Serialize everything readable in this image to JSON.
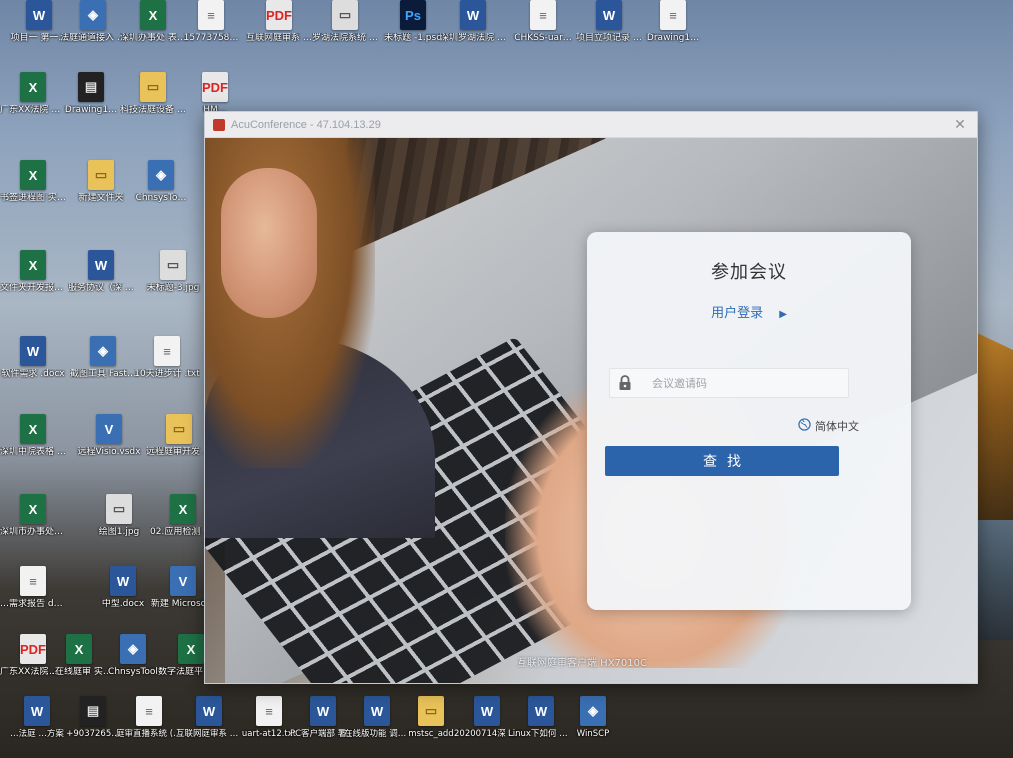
{
  "desktop": {
    "icons": [
      {
        "label": "项目一 第一…",
        "type": "docx",
        "glyph": "W"
      },
      {
        "label": "法庭通道接入 程序",
        "type": "app",
        "glyph": "◈"
      },
      {
        "label": "深圳办事处 表.xlsx",
        "type": "xlsx",
        "glyph": "X"
      },
      {
        "label": "15773758…",
        "type": "txt",
        "glyph": "≡"
      },
      {
        "label": "互联网庭审系 统.pdf",
        "type": "pdf",
        "glyph": "PDF"
      },
      {
        "label": "罗湖法院系统 ID.jpg",
        "type": "img",
        "glyph": "▭"
      },
      {
        "label": "未标题 -1.psd",
        "type": "psd",
        "glyph": "Ps"
      },
      {
        "label": "深圳罗湖法院 安装.docx",
        "type": "docx",
        "glyph": "W"
      },
      {
        "label": "CHKSS-uar…",
        "type": "txt",
        "glyph": "≡"
      },
      {
        "label": "项目立项记录 书面.docx",
        "type": "docx",
        "glyph": "W"
      },
      {
        "label": "Drawing1…",
        "type": "txt",
        "glyph": "≡"
      },
      {
        "label": "广东XX法院 庭审…",
        "type": "xlsx",
        "glyph": "X"
      },
      {
        "label": "Drawing1…",
        "type": "dark",
        "glyph": "▤"
      },
      {
        "label": "科技法庭设备 采购（初验）",
        "type": "folder",
        "glyph": "▭"
      },
      {
        "label": "HM…",
        "type": "pdf",
        "glyph": "PDF"
      },
      {
        "label": "书签进程图 实施.xlsx",
        "type": "xlsx",
        "glyph": "X"
      },
      {
        "label": "新建文件夹",
        "type": "folder",
        "glyph": "▭"
      },
      {
        "label": "ChnsysTo…",
        "type": "app",
        "glyph": "◈"
      },
      {
        "label": "文件夹开发报价 书.xlsx",
        "type": "xlsx",
        "glyph": "X"
      },
      {
        "label": "服务协议（深 圳）…",
        "type": "docx",
        "glyph": "W"
      },
      {
        "label": "未标题-3.jpg",
        "type": "img",
        "glyph": "▭"
      },
      {
        "label": "软件需求 .docx",
        "type": "docx",
        "glyph": "W"
      },
      {
        "label": "截图工具 FastStone …",
        "type": "app",
        "glyph": "◈"
      },
      {
        "label": "10天进步计 .txt",
        "type": "txt",
        "glyph": "≡"
      },
      {
        "label": "深圳中院表格 远程庭审…",
        "type": "xlsx",
        "glyph": "X"
      },
      {
        "label": "远程Visio.vsdx",
        "type": "app",
        "glyph": "V"
      },
      {
        "label": "远程庭审开发 实施",
        "type": "folder",
        "glyph": "▭"
      },
      {
        "label": "深圳市办事处设 备2020…",
        "type": "xlsx",
        "glyph": "X"
      },
      {
        "label": "绘图1.jpg",
        "type": "img",
        "glyph": "▭"
      },
      {
        "label": "02.应用检测 表.xlsx",
        "type": "xlsx",
        "glyph": "X"
      },
      {
        "label": "…需求报告 docx",
        "type": "txt",
        "glyph": "≡"
      },
      {
        "label": "中型.docx",
        "type": "docx",
        "glyph": "W"
      },
      {
        "label": "新建 Microso…",
        "type": "app",
        "glyph": "V"
      },
      {
        "label": "广东XX法院 实施计划…",
        "type": "pdf",
        "glyph": "PDF"
      },
      {
        "label": "…在线庭审 实施…",
        "type": "xlsx",
        "glyph": "X"
      },
      {
        "label": "ChnsysTool",
        "type": "app",
        "glyph": "◈"
      },
      {
        "label": "数字法庭平 台设备清单…",
        "type": "xlsx",
        "glyph": "X"
      }
    ],
    "bottom_icons": [
      {
        "label": "…法庭 …方案",
        "type": "docx",
        "glyph": "W"
      },
      {
        "label": "+9037265…",
        "type": "dark",
        "glyph": "▤"
      },
      {
        "label": "庭审直播系统 (2019102…",
        "type": "txt",
        "glyph": "≡"
      },
      {
        "label": "互联网庭审系 统说明 书…",
        "type": "docx",
        "glyph": "W"
      },
      {
        "label": "uart-at12.txt",
        "type": "txt",
        "glyph": "≡"
      },
      {
        "label": "PC客户端部 署使用说…",
        "type": "docx",
        "glyph": "W"
      },
      {
        "label": "在线版功能 调试说明…",
        "type": "docx",
        "glyph": "W"
      },
      {
        "label": "mstsc_add",
        "type": "folder",
        "glyph": "▭"
      },
      {
        "label": "20200714深 圳远程庭审…",
        "type": "docx",
        "glyph": "W"
      },
      {
        "label": "Linux下如何 获取CPU号…",
        "type": "docx",
        "glyph": "W"
      },
      {
        "label": "WinSCP",
        "type": "app",
        "glyph": "◈"
      }
    ]
  },
  "window": {
    "title": "AcuConference - 47.104.13.29",
    "close_glyph": "✕"
  },
  "login": {
    "heading": "参加会议",
    "mode_link": "用户登录",
    "mode_arrow": "▶",
    "code_placeholder": "会议邀请码",
    "language": "简体中文",
    "search_button": "查找"
  },
  "footer": {
    "brand": "互联网庭审客户端 HX7010C"
  },
  "colors": {
    "accent": "#2c64ac",
    "link": "#2f6db5"
  }
}
